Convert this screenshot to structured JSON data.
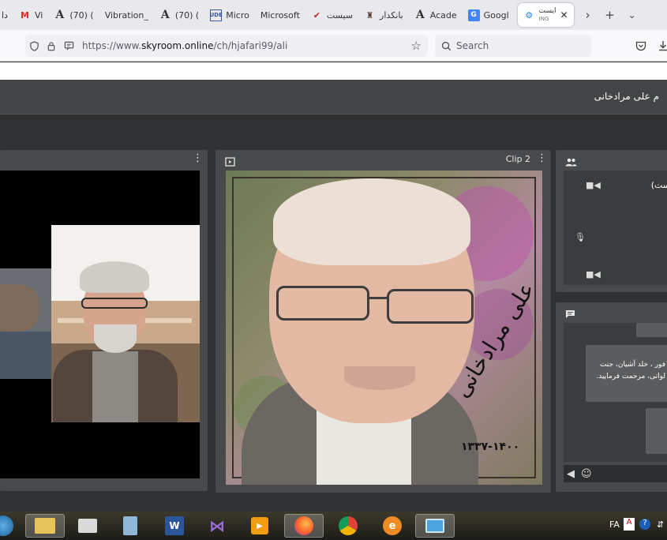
{
  "browser": {
    "tabs": [
      {
        "label": "Vi",
        "icon": "gmail-icon"
      },
      {
        "label": "(70) (",
        "icon": "academia-icon"
      },
      {
        "label": "Vibration_",
        "icon": ""
      },
      {
        "label": "(70) (",
        "icon": "academia-icon"
      },
      {
        "label": "Micro",
        "icon": "udemy-icon"
      },
      {
        "label": "Microsoft",
        "icon": ""
      },
      {
        "label": "سیست",
        "icon": "red-logo-icon"
      },
      {
        "label": "بانکدار",
        "icon": "bank-icon"
      },
      {
        "label": "Acade",
        "icon": "academia-icon"
      },
      {
        "label": "Googl",
        "icon": "google-translate-icon"
      },
      {
        "label": "ING",
        "icon": "skyroom-icon"
      }
    ],
    "left_fragment": "دا",
    "active_tab_line1": "ایست",
    "url_prefix": "https://www.",
    "url_host": "skyroom.online",
    "url_path": "/ch/hjafari99/ali",
    "search_placeholder": "Search"
  },
  "room": {
    "title": "م علی مرادخانی"
  },
  "clip_panel": {
    "label": "Clip 2",
    "calligraphy": "علی مرادخانی",
    "years": "۱۳۳۷-۱۴۰۰"
  },
  "users": {
    "name_fragment": "ست)"
  },
  "chat": {
    "messages": [
      {
        "lines": [
          "فور ، خلد آشیان، جنت",
          "لواتی، مرحمت فرمایید."
        ]
      }
    ]
  },
  "taskbar": {
    "lang": "FA",
    "apps": [
      "start",
      "explorer",
      "printer",
      "calculator",
      "word",
      "visual-studio",
      "media-player",
      "firefox",
      "chrome",
      "edge-legacy",
      "remote-desktop"
    ]
  },
  "colors": {
    "room_bg": "#2f3133",
    "panel": "#47494b",
    "panel_inner": "#3a3c3e",
    "header": "#424446"
  }
}
